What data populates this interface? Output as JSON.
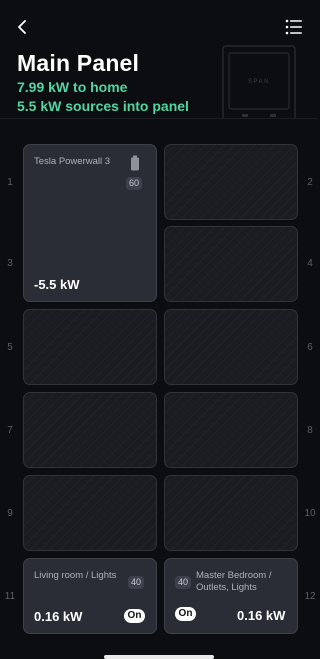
{
  "header": {
    "title": "Main Panel",
    "home_power": "7.99 kW to home",
    "sources_power": "5.5 kW sources into panel",
    "panel_brand": "SPAN"
  },
  "slots": {
    "s1": "1",
    "s2": "2",
    "s3": "3",
    "s4": "4",
    "s5": "5",
    "s6": "6",
    "s7": "7",
    "s8": "8",
    "s9": "9",
    "s10": "10",
    "s11": "11",
    "s12": "12"
  },
  "breakers": {
    "powerwall": {
      "label": "Tesla Powerwall 3",
      "battery_level": "60",
      "power": "-5.5 kW"
    },
    "living_room": {
      "label": "Living room / Lights",
      "amps": "40",
      "power": "0.16 kW",
      "toggle": "On"
    },
    "master_bedroom": {
      "label": "Master Bedroom / Outlets, Lights",
      "amps": "40",
      "power": "0.16 kW",
      "toggle": "On"
    }
  },
  "colors": {
    "accent_green": "#4fd6a3",
    "background": "#0c0d10",
    "breaker_empty": "#1a1c22",
    "breaker_active": "#2a2d36"
  }
}
